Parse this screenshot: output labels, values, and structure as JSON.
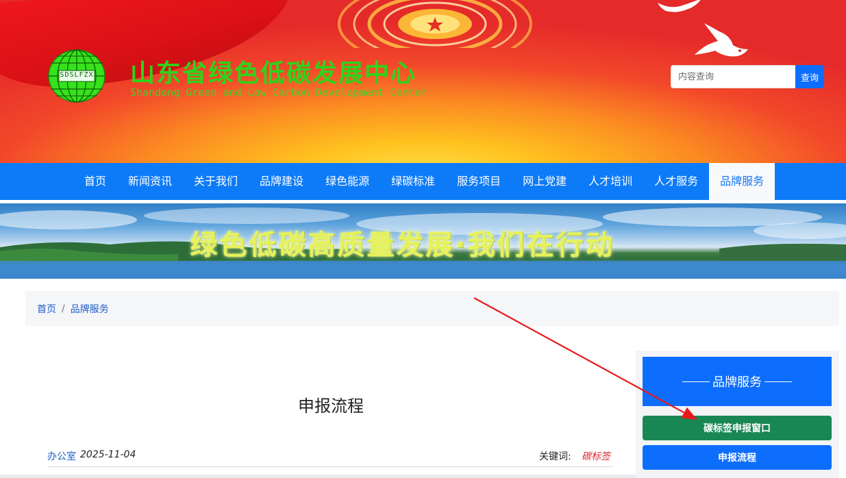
{
  "header": {
    "logo_text": "SDSLFZX",
    "title_cn": "山东省绿色低碳发展中心",
    "title_en": "Shandong Green and Low Carbon Development Center",
    "search_placeholder": "内容查询",
    "search_button": "查询"
  },
  "nav": {
    "items": [
      {
        "label": "首页"
      },
      {
        "label": "新闻资讯"
      },
      {
        "label": "关于我们"
      },
      {
        "label": "品牌建设"
      },
      {
        "label": "绿色能源"
      },
      {
        "label": "绿碳标准"
      },
      {
        "label": "服务项目"
      },
      {
        "label": "网上党建"
      },
      {
        "label": "人才培训"
      },
      {
        "label": "人才服务"
      },
      {
        "label": "品牌服务"
      }
    ],
    "active": "品牌服务"
  },
  "banner": {
    "slogan": "绿色低碳高质量发展·我们在行动"
  },
  "breadcrumb": {
    "home": "首页",
    "separator": "/",
    "current": "品牌服务"
  },
  "article": {
    "title": "申报流程",
    "author": "办公室",
    "date": "2025-11-04",
    "keywords_label": "关键词:",
    "keywords": "碳标签"
  },
  "sidebar": {
    "heading": "品牌服务",
    "buttons": [
      {
        "label": "碳标签申报窗口"
      },
      {
        "label": "申报流程"
      }
    ]
  },
  "colors": {
    "nav_bg": "#0d7bf7",
    "primary": "#0d6efd",
    "success": "#198754",
    "title_green": "#2fd31a",
    "annotation_red": "#e8191c"
  }
}
